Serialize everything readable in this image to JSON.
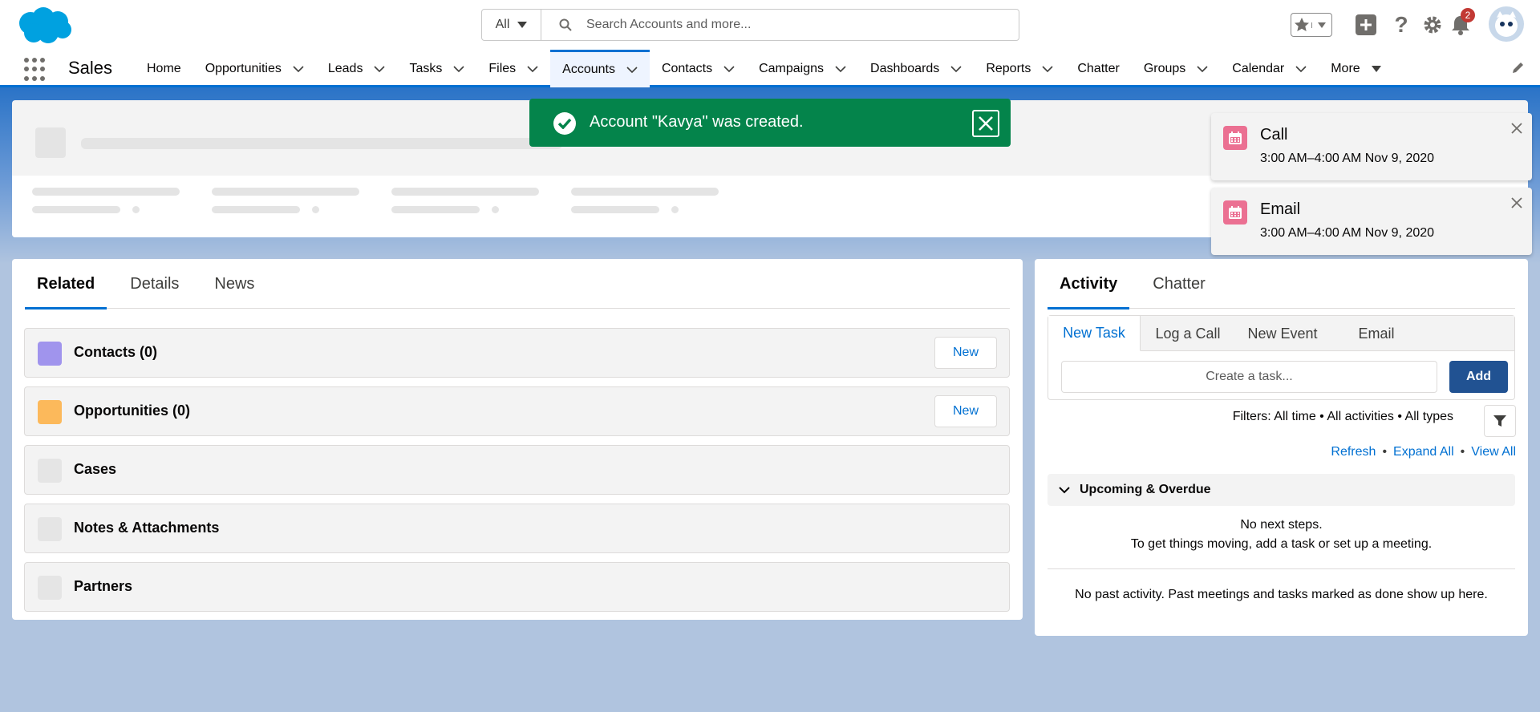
{
  "header": {
    "search_scope": "All",
    "search_placeholder": "Search Accounts and more...",
    "notification_count": "2",
    "icons": [
      "salesforce-cloud-logo",
      "search-icon",
      "star-icon",
      "add-icon",
      "help-icon",
      "gear-icon",
      "bell-icon",
      "avatar"
    ]
  },
  "context": {
    "app_name": "Sales",
    "nav": [
      {
        "label": "Home"
      },
      {
        "label": "Opportunities"
      },
      {
        "label": "Leads"
      },
      {
        "label": "Tasks"
      },
      {
        "label": "Files"
      },
      {
        "label": "Accounts",
        "active": true
      },
      {
        "label": "Contacts"
      },
      {
        "label": "Campaigns"
      },
      {
        "label": "Dashboards"
      },
      {
        "label": "Reports"
      },
      {
        "label": "Chatter"
      },
      {
        "label": "Groups"
      },
      {
        "label": "Calendar"
      },
      {
        "label": "More"
      }
    ]
  },
  "toast": {
    "message": "Account \"Kavya\" was created."
  },
  "reminders": [
    {
      "title": "Call",
      "time": "3:00 AM–4:00 AM Nov 9, 2020"
    },
    {
      "title": "Email",
      "time": "3:00 AM–4:00 AM Nov 9, 2020"
    }
  ],
  "related": {
    "tabs": [
      "Related",
      "Details",
      "News"
    ],
    "items": [
      {
        "label": "Contacts (0)",
        "button": "New",
        "icon_color": "#a094ed"
      },
      {
        "label": "Opportunities (0)",
        "button": "New",
        "icon_color": "#fcb95b"
      },
      {
        "label": "Cases"
      },
      {
        "label": "Notes & Attachments"
      },
      {
        "label": "Partners"
      }
    ]
  },
  "activity": {
    "tabs": [
      "Activity",
      "Chatter"
    ],
    "publisher_tabs": [
      "New Task",
      "Log a Call",
      "New Event",
      "Email"
    ],
    "task_placeholder": "Create a task...",
    "add_label": "Add",
    "filters": "Filters: All time • All activities • All types",
    "links": [
      "Refresh",
      "Expand All",
      "View All"
    ],
    "upcoming": "Upcoming & Overdue",
    "no_steps_1": "No next steps.",
    "no_steps_2": "To get things moving, add a task or set up a meeting.",
    "past": "No past activity. Past meetings and tasks marked as done show up here."
  },
  "colors": {
    "brand": "#0070d2",
    "success": "#04844b",
    "event_icon": "#eb7092",
    "add_button": "#215292"
  }
}
